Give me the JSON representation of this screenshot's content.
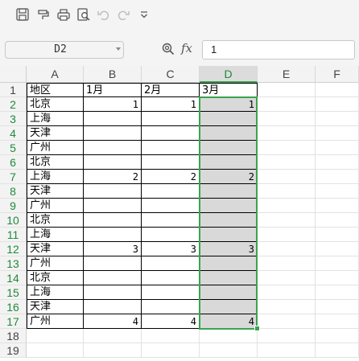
{
  "toolbar": {
    "icons": [
      "save-icon",
      "format-painter-icon",
      "print-icon",
      "print-preview-icon",
      "undo-icon",
      "redo-icon",
      "more-icon"
    ]
  },
  "formula_bar": {
    "cell_ref": "D2",
    "fx": "fx",
    "value": "1"
  },
  "grid": {
    "columns": [
      "A",
      "B",
      "C",
      "D",
      "E",
      "F"
    ],
    "active_column": "D",
    "rows": [
      "1",
      "2",
      "3",
      "4",
      "5",
      "6",
      "7",
      "8",
      "9",
      "10",
      "11",
      "12",
      "13",
      "14",
      "15",
      "16",
      "17",
      "18",
      "19"
    ],
    "header": [
      "地区",
      "1月",
      "2月",
      "3月"
    ],
    "data": [
      [
        "北京",
        "1",
        "1",
        "1"
      ],
      [
        "上海",
        "",
        "",
        ""
      ],
      [
        "天津",
        "",
        "",
        ""
      ],
      [
        "广州",
        "",
        "",
        ""
      ],
      [
        "北京",
        "",
        "",
        ""
      ],
      [
        "上海",
        "2",
        "2",
        "2"
      ],
      [
        "天津",
        "",
        "",
        ""
      ],
      [
        "广州",
        "",
        "",
        ""
      ],
      [
        "北京",
        "",
        "",
        ""
      ],
      [
        "上海",
        "",
        "",
        ""
      ],
      [
        "天津",
        "3",
        "3",
        "3"
      ],
      [
        "广州",
        "",
        "",
        ""
      ],
      [
        "北京",
        "",
        "",
        ""
      ],
      [
        "上海",
        "",
        "",
        ""
      ],
      [
        "天津",
        "",
        "",
        ""
      ],
      [
        "广州",
        "4",
        "4",
        "4"
      ]
    ],
    "selection": "D2:D17"
  },
  "colors": {
    "accent": "#3aa34e",
    "selection_fill": "#d9d9d9",
    "header_bg": "#f3f3f3"
  }
}
